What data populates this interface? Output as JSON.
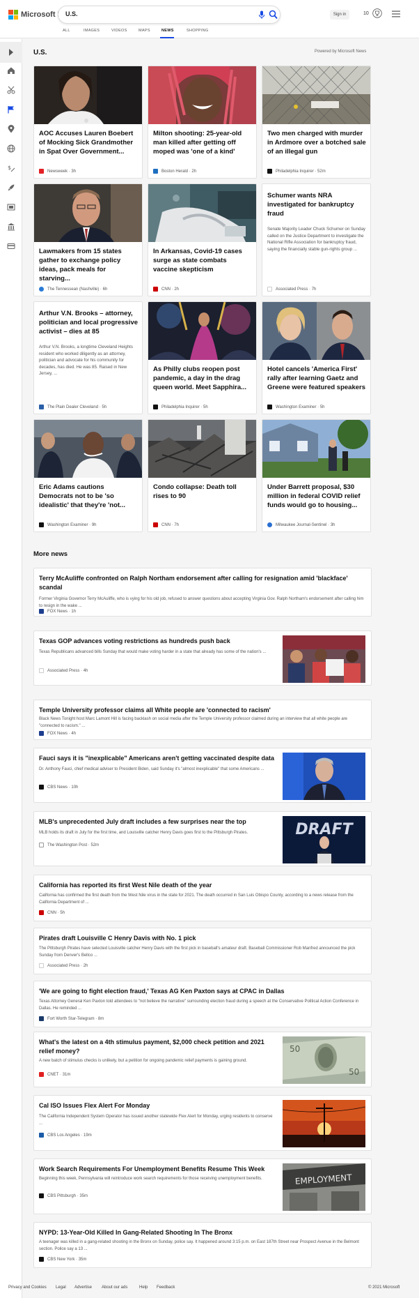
{
  "header": {
    "brand": "Microsoft Bing",
    "query": "U.S.",
    "signin": "Sign in",
    "points": "10",
    "logo_colors": [
      "#f25022",
      "#7fba00",
      "#00a4ef",
      "#ffb900"
    ]
  },
  "nav": [
    "ALL",
    "IMAGES",
    "VIDEOS",
    "MAPS",
    "NEWS",
    "SHOPPING"
  ],
  "nav_active": "NEWS",
  "section": {
    "title": "U.S.",
    "powered_by": "Powered by Microsoft News"
  },
  "cards": [
    {
      "title": "AOC Accuses Lauren Boebert of Mocking Sick Grandmother in Spat Over Government...",
      "source": "Newsweek",
      "time": "3h"
    },
    {
      "title": "Milton shooting: 25-year-old man killed after getting off moped was 'one of a kind'",
      "source": "Boston Herald",
      "time": "2h"
    },
    {
      "title": "Two men charged with murder in Ardmore over a botched sale of an illegal gun",
      "source": "Philadelphia Inquirer",
      "time": "52m"
    },
    {
      "title": "Lawmakers from 15 states gather to exchange policy ideas, pack meals for starving...",
      "source": "The Tennessean (Nashville)",
      "time": "6h"
    },
    {
      "title": "In Arkansas, Covid-19 cases surge as state combats vaccine skepticism",
      "source": "CNN",
      "time": "2h"
    },
    {
      "title": "Schumer wants NRA investigated for bankruptcy fraud",
      "snippet": "Senate Majority Leader Chuck Schumer on Sunday called on the Justice Department to investigate the National Rifle Association for bankruptcy fraud, saying the financially stable gun-rights group ...",
      "source": "Associated Press",
      "time": "7h"
    },
    {
      "title": "Arthur V.N. Brooks – attorney, politician and local progressive activist – dies at 85",
      "snippet": "Arthur V.N. Brooks, a longtime Cleveland Heights resident who worked diligently as an attorney, politician and advocate for his community for decades, has died. He was 85. Raised in New Jersey, ...",
      "source": "The Plain Dealer Cleveland",
      "time": "5h"
    },
    {
      "title": "As Philly clubs reopen post pandemic, a day in the drag queen world. Meet Sapphira...",
      "source": "Philadelphia Inquirer",
      "time": "5h"
    },
    {
      "title": "Hotel cancels 'America First' rally after learning Gaetz and Greene were featured speakers",
      "source": "Washington Examiner",
      "time": "5h"
    },
    {
      "title": "Eric Adams cautions Democrats not to be 'so idealistic' that they're 'not...",
      "source": "Washington Examiner",
      "time": "9h"
    },
    {
      "title": "Condo collapse: Death toll rises to 90",
      "source": "CNN",
      "time": "7h"
    },
    {
      "title": "Under Barrett proposal, $30 million in federal COVID relief funds would go to housing...",
      "source": "Milwaukee Journal-Sentinel",
      "time": "3h"
    }
  ],
  "more_news": {
    "title": "More news",
    "items": [
      {
        "title": "Terry McAuliffe confronted on Ralph Northam endorsement after calling for resignation amid 'blackface' scandal",
        "snippet": "Former Virginia Governor Terry McAuliffe, who is vying for his old job, refused to answer questions about accepting Virginia Gov. Ralph Northam's endorsement after calling him to resign in the wake ...",
        "source": "FOX News",
        "time": "1h"
      },
      {
        "title": "Texas GOP advances voting restrictions as hundreds push back",
        "snippet": "Texas Republicans advanced bills Sunday that would make voting harder in a state that already has some of the nation's ...",
        "source": "Associated Press",
        "time": "4h"
      },
      {
        "title": "Temple University professor claims all White people are 'connected to racism'",
        "snippet": "Black News Tonight host Marc Lamont Hill is facing backlash on social media after the Temple University professor claimed during an interview that all white people are \"connected to racism.\" ...",
        "source": "FOX News",
        "time": "4h"
      },
      {
        "title": "Fauci says it is \"inexplicable\" Americans aren't getting vaccinated despite data",
        "snippet": "Dr. Anthony Fauci, chief medical adviser to President Biden, said Sunday it's \"almost inexplicable\" that some Americans ...",
        "source": "CBS News",
        "time": "10h"
      },
      {
        "title": "MLB's unprecedented July draft includes a few surprises near the top",
        "snippet": "MLB holds its draft in July for the first time, and Louisville catcher Henry Davis goes first to the Pittsburgh Pirates.",
        "source": "The Washington Post",
        "time": "52m",
        "image_text": "DRAFT"
      },
      {
        "title": "California has reported its first West Nile death of the year",
        "snippet": "California has confirmed the first death from the West Nile virus in the state for 2021. The death occurred in San Luis Obispo County, according to a news release from the California Department of ...",
        "source": "CNN",
        "time": "5h"
      },
      {
        "title": "Pirates draft Louisville C Henry Davis with No. 1 pick",
        "snippet": "The Pittsburgh Pirates have selected Louisville catcher Henry Davis with the first pick in baseball's amateur draft. Baseball Commissioner Rob Manfred announced the pick Sunday from Denver's Bellco ...",
        "source": "Associated Press",
        "time": "2h"
      },
      {
        "title": "'We are going to fight election fraud,' Texas AG Ken Paxton says at CPAC in Dallas",
        "snippet": "Texas Attorney General Ken Paxton told attendees to \"not believe the narrative\" surrounding election fraud during a speech at the Conservative Political Action Conference in Dallas. He reminded ...",
        "source": "Fort Worth Star-Telegram",
        "time": "8m"
      },
      {
        "title": "What's the latest on a 4th stimulus payment, $2,000 check petition and 2021 relief money?",
        "snippet": "A new batch of stimulus checks is unlikely, but a petition for ongoing pandemic relief payments is gaining ground.",
        "source": "CNET",
        "time": "31m"
      },
      {
        "title": "Cal ISO Issues Flex Alert For Monday",
        "snippet": "The California Independent System Operator has issued another statewide Flex Alert for Monday, urging residents to conserve ...",
        "source": "CBS Los Angeles",
        "time": "19m"
      },
      {
        "title": "Work Search Requirements For Unemployment Benefits Resume This Week",
        "snippet": "Beginning this week, Pennsylvania will reintroduce work search requirements for those receiving unemployment benefits.",
        "source": "CBS Pittsburgh",
        "time": "35m",
        "image_text": "EMPLOYMENT"
      },
      {
        "title": "NYPD: 13-Year-Old Killed In Gang-Related Shooting In The Bronx",
        "snippet": "A teenager was killed in a gang-related shooting in the Bronx on Sunday, police say. It happened around 3:15 p.m. on East 187th Street near Prospect Avenue in the Belmont section. Police say a 13 ...",
        "source": "CBS New York",
        "time": "35m"
      }
    ]
  },
  "footer": {
    "links": [
      "Privacy and Cookies",
      "Legal",
      "Advertise",
      "About our ads",
      "Help",
      "Feedback"
    ],
    "copyright": "© 2021 Microsoft"
  }
}
